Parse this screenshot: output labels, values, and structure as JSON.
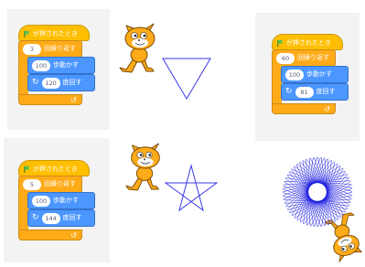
{
  "colors": {
    "events": "#ffbf00",
    "control": "#ffab19",
    "motion": "#4c97ff",
    "pen": "#2a2ae0",
    "panel": "#f3f3f3"
  },
  "labels": {
    "when_flag_clicked": "が押されたとき",
    "repeat_suffix": "回繰り返す",
    "move_suffix": "歩動かす",
    "turn_suffix": "度回す"
  },
  "scripts": {
    "triangle": {
      "repeat": "3",
      "move": "100",
      "turn": "120"
    },
    "hexagon": {
      "repeat": "60",
      "move": "100",
      "turn": "81"
    },
    "star": {
      "repeat": "5",
      "move": "100",
      "turn": "144"
    }
  },
  "icons": {
    "flag": "green-flag-icon",
    "loop": "loop-arrow-icon",
    "turn": "rotate-right-icon"
  }
}
